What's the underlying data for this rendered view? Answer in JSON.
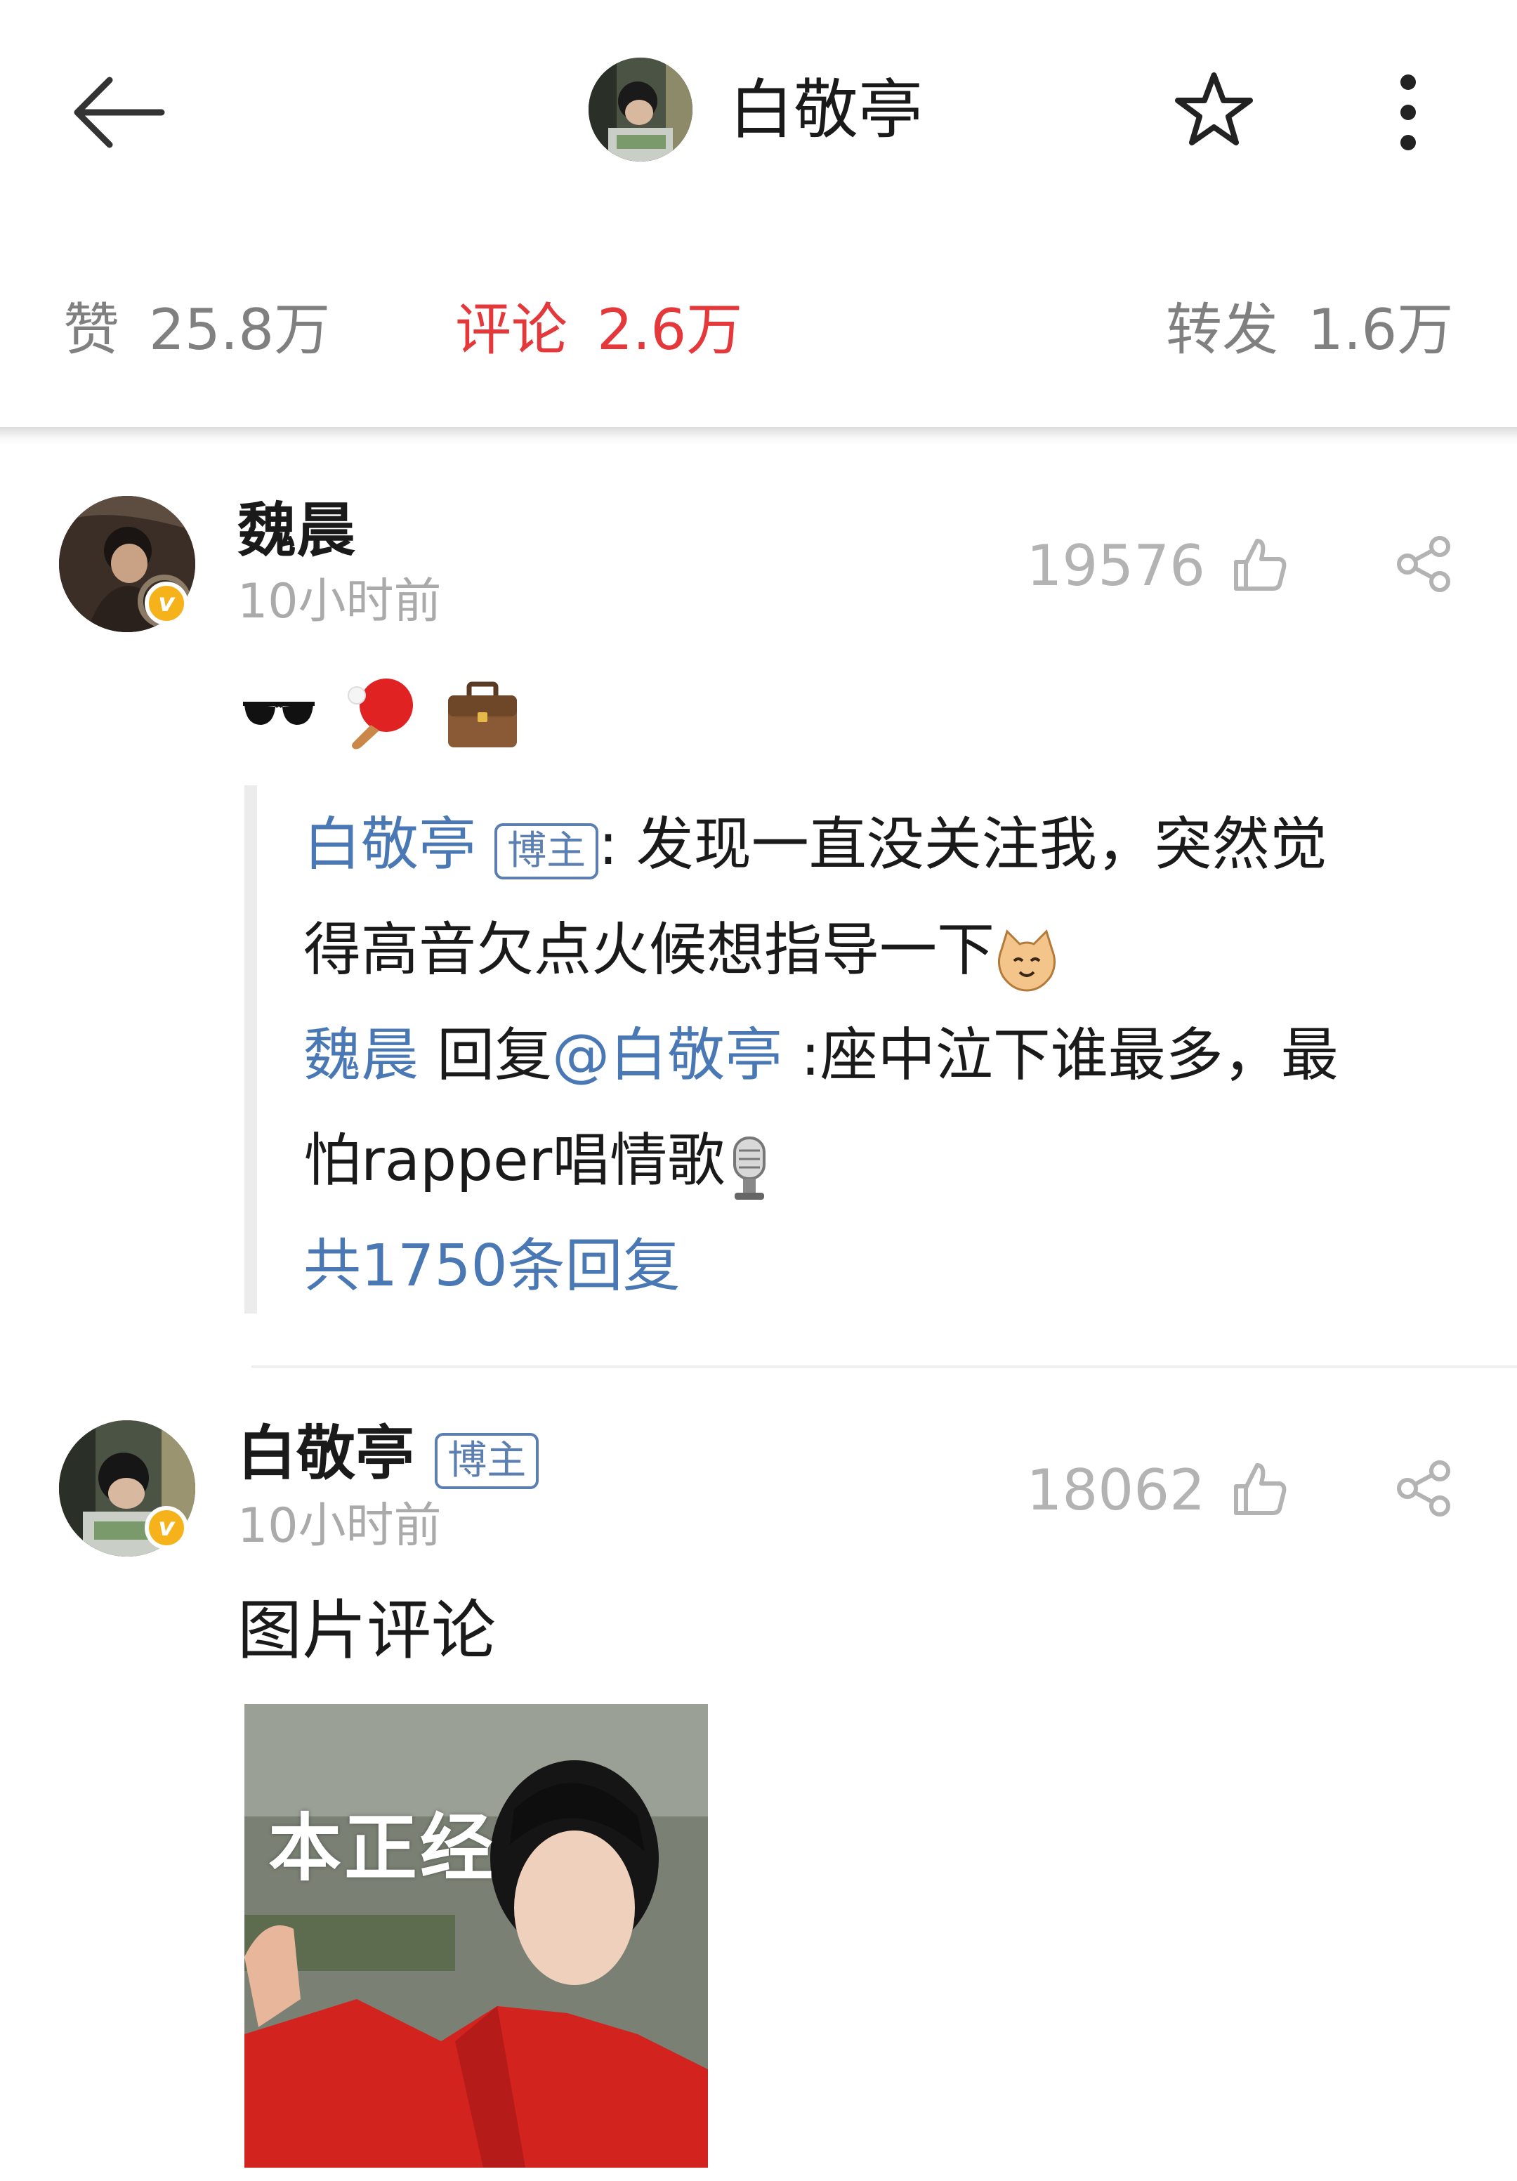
{
  "header": {
    "title": "白敬亭"
  },
  "stats": {
    "likes": {
      "label": "赞",
      "value": "25.8万"
    },
    "comments": {
      "label": "评论",
      "value": "2.6万"
    },
    "reposts": {
      "label": "转发",
      "value": "1.6万"
    },
    "active_tab": "comments",
    "accent_color": "#e5383b"
  },
  "comments": [
    {
      "username": "魏晨",
      "time": "10小时前",
      "likes": "19576",
      "emojis": [
        "sunglasses",
        "ping-pong",
        "briefcase"
      ],
      "reply_thread": {
        "line1_user": "白敬亭",
        "line1_badge": "博主",
        "line1_text": ": 发现一直没关注我，突然觉",
        "line2_text": "得高音欠点火候想指导一下",
        "line3_user": "魏晨",
        "line3_reply": " 回复",
        "line3_mention": "@白敬亭",
        "line3_text": " :座中泣下谁最多，最",
        "line4_text": "怕rapper唱情歌",
        "more_replies": "共1750条回复"
      }
    },
    {
      "username": "白敬亭",
      "badge": "博主",
      "time": "10小时前",
      "likes": "18062",
      "text": "图片评论",
      "image_caption": "本正经"
    }
  ]
}
